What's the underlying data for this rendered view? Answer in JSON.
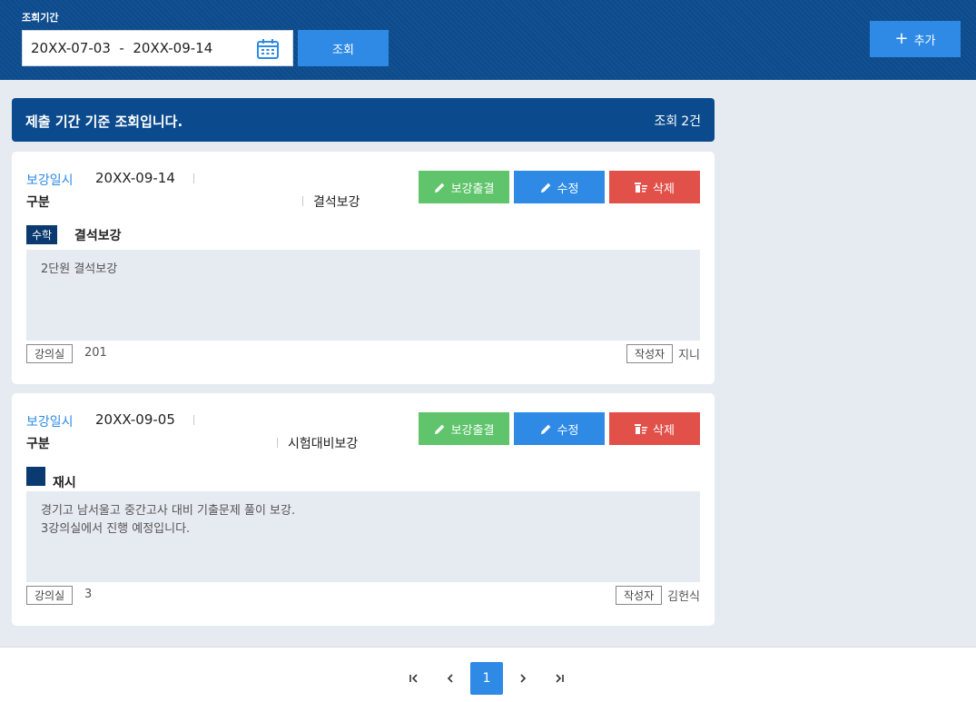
{
  "header": {
    "period_label": "조회기간",
    "date_range": "20XX-07-03  -  20XX-09-14",
    "search_label": "조회",
    "add_label": "추가"
  },
  "info_bar": {
    "message": "제출 기간 기준 조회입니다.",
    "count_prefix": "조회",
    "count": "2건"
  },
  "cards": [
    {
      "date_label": "보강일시",
      "date": "20XX-09-14",
      "kind_label": "구분",
      "kind": "결석보강",
      "actions": {
        "attend": "보강출결",
        "edit": "수정",
        "delete": "삭제"
      },
      "subject": "수학",
      "title": "결석보강",
      "content": [
        "2단원 결석보강"
      ],
      "room_label": "강의실",
      "room": "201",
      "author_label": "작성자",
      "author": "지니"
    },
    {
      "date_label": "보강일시",
      "date": "20XX-09-05",
      "kind_label": "구분",
      "kind": "시험대비보강",
      "actions": {
        "attend": "보강출결",
        "edit": "수정",
        "delete": "삭제"
      },
      "subject": "",
      "title": "재시",
      "content": [
        "경기고 남서울고 중간고사 대비 기출문제 풀이 보강.",
        "3강의실에서 진행 예정입니다."
      ],
      "room_label": "강의실",
      "room": "3",
      "author_label": "작성자",
      "author": "김헌식"
    }
  ],
  "pagination": {
    "current": "1"
  },
  "colors": {
    "primary_dark": "#0b4a8c",
    "primary": "#2f8ae6",
    "success": "#5fc46b",
    "danger": "#e2504a",
    "background": "#e6eaf1"
  },
  "icons": [
    "calendar-icon",
    "plus-icon",
    "pencil-icon",
    "trash-icon",
    "first-page-icon",
    "prev-page-icon",
    "next-page-icon",
    "last-page-icon"
  ]
}
